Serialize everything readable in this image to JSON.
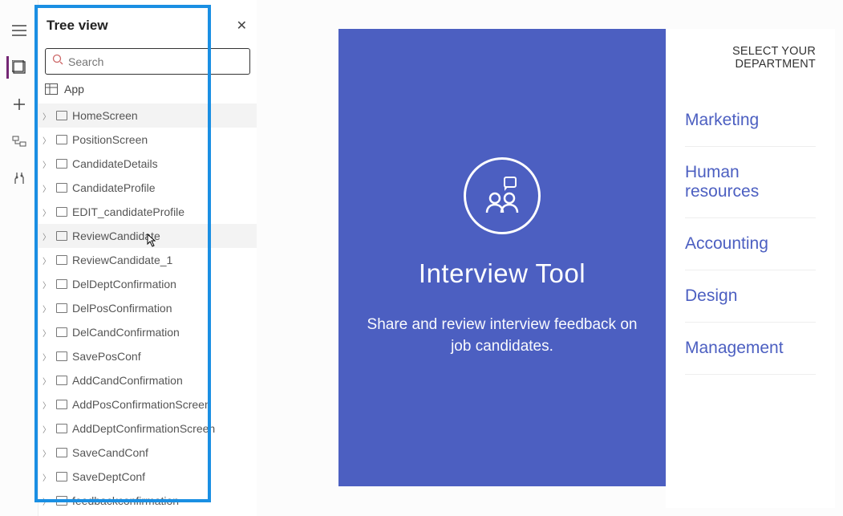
{
  "panel": {
    "title": "Tree view",
    "search_placeholder": "Search",
    "app_label": "App"
  },
  "screens": [
    {
      "label": "HomeScreen",
      "selected": true,
      "more": true
    },
    {
      "label": "PositionScreen"
    },
    {
      "label": "CandidateDetails"
    },
    {
      "label": "CandidateProfile"
    },
    {
      "label": "EDIT_candidateProfile"
    },
    {
      "label": "ReviewCandidate",
      "hovered": true,
      "more": true
    },
    {
      "label": "ReviewCandidate_1"
    },
    {
      "label": "DelDeptConfirmation"
    },
    {
      "label": "DelPosConfirmation"
    },
    {
      "label": "DelCandConfirmation"
    },
    {
      "label": "SavePosConf"
    },
    {
      "label": "AddCandConfirmation"
    },
    {
      "label": "AddPosConfirmationScreen"
    },
    {
      "label": "AddDeptConfirmationScreen"
    },
    {
      "label": "SaveCandConf"
    },
    {
      "label": "SaveDeptConf"
    },
    {
      "label": "feedbackconfirmation"
    }
  ],
  "preview": {
    "title": "Interview Tool",
    "subtitle": "Share and review interview feedback on job candidates."
  },
  "dept": {
    "heading": "SELECT YOUR DEPARTMENT",
    "items": [
      "Marketing",
      "Human resources",
      "Accounting",
      "Design",
      "Management"
    ]
  }
}
